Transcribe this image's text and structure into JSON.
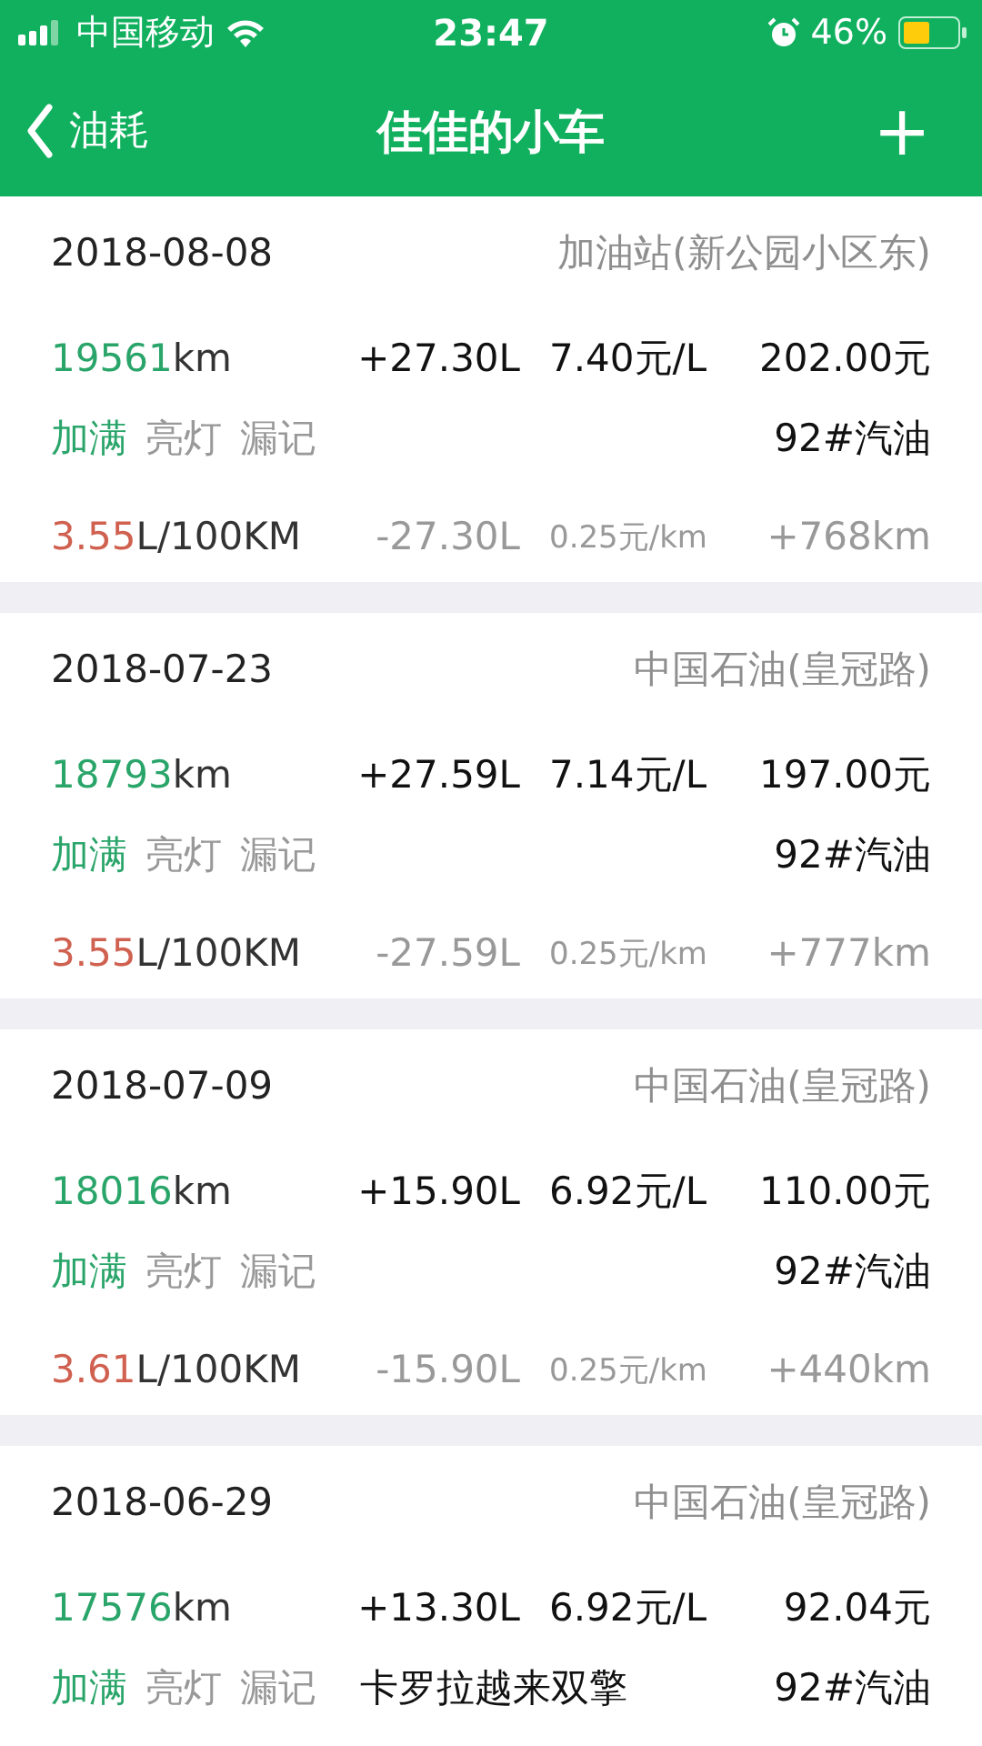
{
  "status_bar": {
    "carrier": "中国移动",
    "time": "23:47",
    "battery": "46%"
  },
  "nav_bar": {
    "back_label": "油耗",
    "title": "佳佳的小车",
    "add": "+"
  },
  "records": [
    {
      "date": "2018-08-08",
      "station": "加油站(新公园小区东)",
      "odometer": "19561",
      "odometer_unit": "km",
      "volume": "+27.30L",
      "price": "7.40元/L",
      "total": "202.00元",
      "tags": [
        {
          "label": "加满",
          "on": true
        },
        {
          "label": "亮灯",
          "on": false
        },
        {
          "label": "漏记",
          "on": false
        }
      ],
      "fuel": "92#汽油",
      "consumption": "3.55",
      "consumption_unit": "L/100KM",
      "used": "-27.30L",
      "cost_per_km": "0.25元/km",
      "distance": "+768km"
    },
    {
      "date": "2018-07-23",
      "station": "中国石油(皇冠路)",
      "odometer": "18793",
      "odometer_unit": "km",
      "volume": "+27.59L",
      "price": "7.14元/L",
      "total": "197.00元",
      "tags": [
        {
          "label": "加满",
          "on": true
        },
        {
          "label": "亮灯",
          "on": false
        },
        {
          "label": "漏记",
          "on": false
        }
      ],
      "fuel": "92#汽油",
      "consumption": "3.55",
      "consumption_unit": "L/100KM",
      "used": "-27.59L",
      "cost_per_km": "0.25元/km",
      "distance": "+777km"
    },
    {
      "date": "2018-07-09",
      "station": "中国石油(皇冠路)",
      "odometer": "18016",
      "odometer_unit": "km",
      "volume": "+15.90L",
      "price": "6.92元/L",
      "total": "110.00元",
      "tags": [
        {
          "label": "加满",
          "on": true
        },
        {
          "label": "亮灯",
          "on": false
        },
        {
          "label": "漏记",
          "on": false
        }
      ],
      "fuel": "92#汽油",
      "consumption": "3.61",
      "consumption_unit": "L/100KM",
      "used": "-15.90L",
      "cost_per_km": "0.25元/km",
      "distance": "+440km"
    },
    {
      "date": "2018-06-29",
      "station": "中国石油(皇冠路)",
      "odometer": "17576",
      "odometer_unit": "km",
      "volume": "+13.30L",
      "price": "6.92元/L",
      "total": "92.04元",
      "tags": [
        {
          "label": "加满",
          "on": true
        },
        {
          "label": "亮灯",
          "on": false
        },
        {
          "label": "漏记",
          "on": false
        }
      ],
      "note": "卡罗拉越来双擎",
      "fuel": "92#汽油"
    }
  ]
}
